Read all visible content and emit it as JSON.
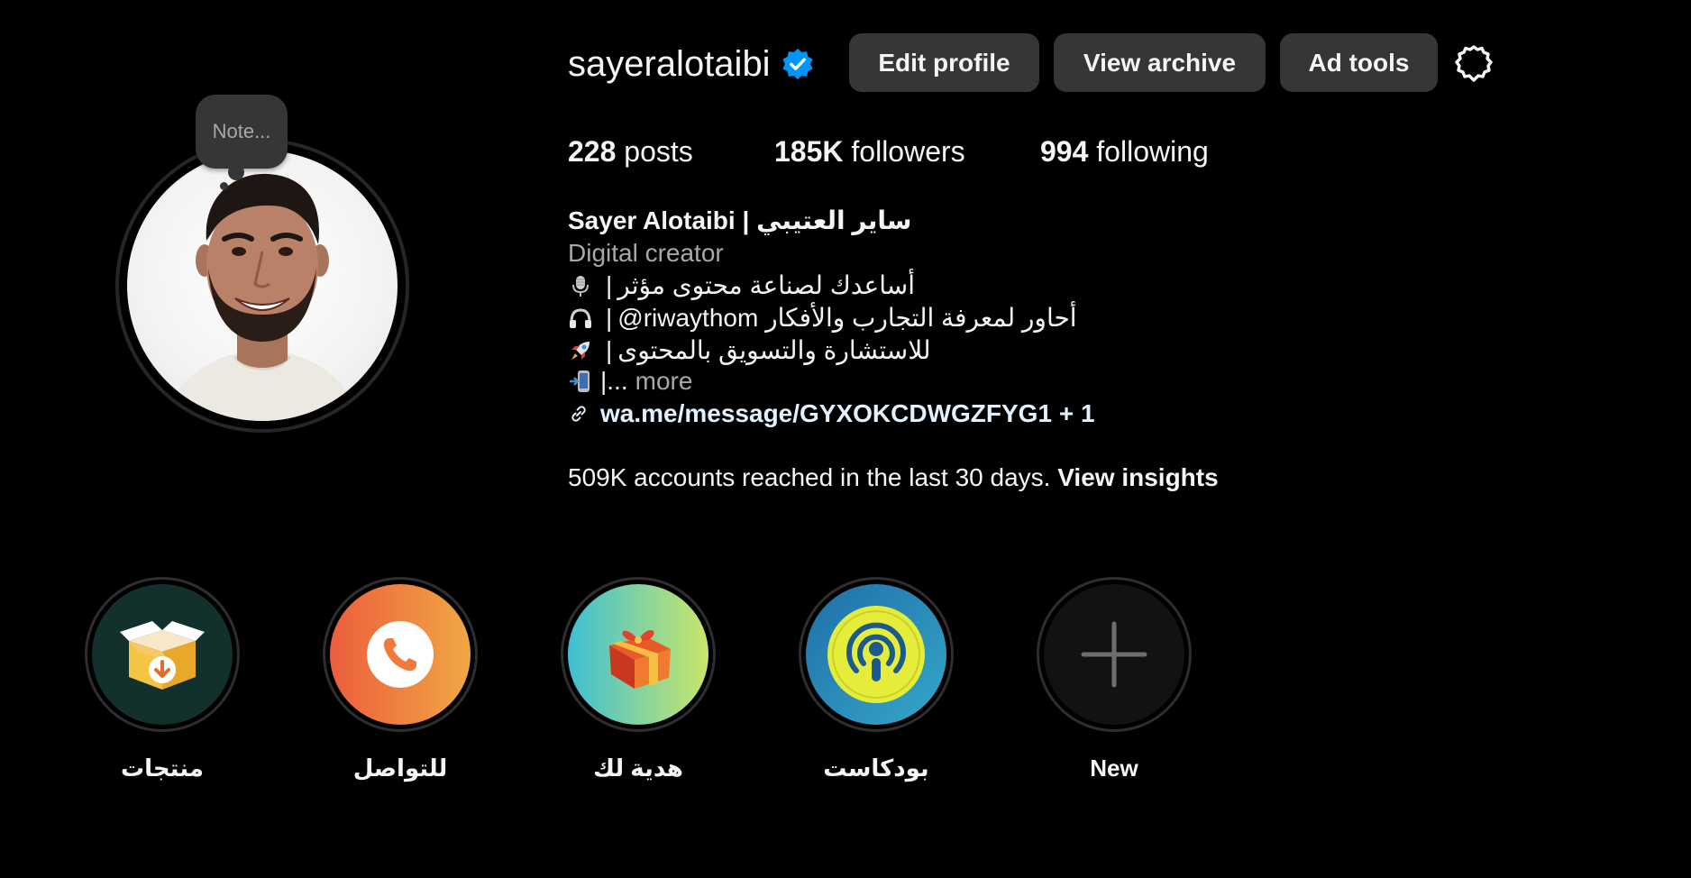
{
  "profile": {
    "username": "sayeralotaibi",
    "note_placeholder": "Note...",
    "buttons": {
      "edit_profile": "Edit profile",
      "view_archive": "View archive",
      "ad_tools": "Ad tools"
    },
    "stats": {
      "posts_count": "228",
      "posts_label": "posts",
      "followers_count": "185K",
      "followers_label": "followers",
      "following_count": "994",
      "following_label": "following"
    }
  },
  "bio": {
    "name": "Sayer Alotaibi | ساير العتيبي",
    "category": "Digital creator",
    "lines": [
      {
        "icon": "microphone-icon",
        "text": "أساعدك لصناعة محتوى مؤثر"
      },
      {
        "icon": "headphones-icon",
        "text": "@riwaythom أحاور لمعرفة التجارب والأفكار"
      },
      {
        "icon": "rocket-icon",
        "text": "للاستشارة والتسويق بالمحتوى"
      },
      {
        "icon": "phone-arrow-icon",
        "text": "..."
      }
    ],
    "separator": "|",
    "more_label": "more",
    "link_text": "wa.me/message/GYXOKCDWGZFYG1 + 1"
  },
  "insights": {
    "text": "509K accounts reached in the last 30 days.",
    "link": "View insights"
  },
  "highlights": [
    {
      "label": "منتجات",
      "icon": "box-download-icon",
      "color": "#12302c"
    },
    {
      "label": "للتواصل",
      "icon": "phone-icon",
      "color": "#ee6a3c"
    },
    {
      "label": "هدية لك",
      "icon": "gift-icon",
      "color": "#5ec6c8"
    },
    {
      "label": "بودكاست",
      "icon": "podcast-icon",
      "color": "#2a86b6"
    },
    {
      "label": "New",
      "icon": "plus-icon",
      "color": "#121212"
    }
  ],
  "colors": {
    "background": "#000000",
    "button": "#363636",
    "verified": "#0095f6",
    "link": "#e0f1ff",
    "secondary_text": "#a8a8a8"
  }
}
